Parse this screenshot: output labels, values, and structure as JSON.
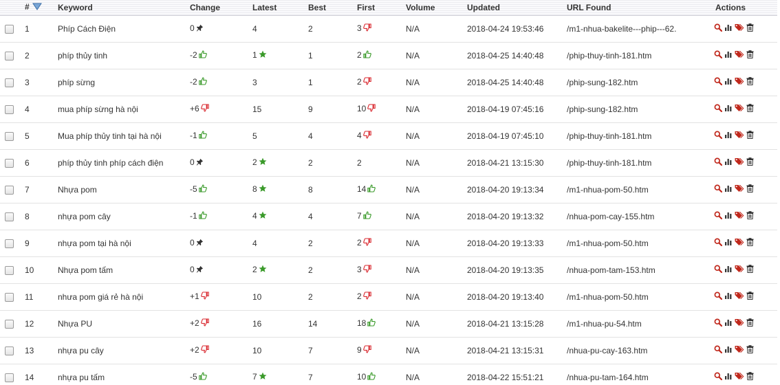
{
  "table": {
    "headers": {
      "index": "#",
      "keyword": "Keyword",
      "change": "Change",
      "latest": "Latest",
      "best": "Best",
      "first": "First",
      "volume": "Volume",
      "updated": "Updated",
      "url": "URL Found",
      "actions": "Actions"
    },
    "rows": [
      {
        "idx": "1",
        "keyword": "Phíp Cách Điện",
        "change": "0",
        "change_icon": "pin",
        "latest": "4",
        "latest_icon": "none",
        "best": "2",
        "first": "3",
        "first_icon": "thumbs-down",
        "volume": "N/A",
        "updated": "2018-04-24 19:53:46",
        "url": "/m1-nhua-bakelite---phip---62."
      },
      {
        "idx": "2",
        "keyword": "phíp thủy tinh",
        "change": "-2",
        "change_icon": "thumbs-up",
        "latest": "1",
        "latest_icon": "star",
        "best": "1",
        "first": "2",
        "first_icon": "thumbs-up",
        "volume": "N/A",
        "updated": "2018-04-25 14:40:48",
        "url": "/phip-thuy-tinh-181.htm"
      },
      {
        "idx": "3",
        "keyword": "phíp sừng",
        "change": "-2",
        "change_icon": "thumbs-up",
        "latest": "3",
        "latest_icon": "none",
        "best": "1",
        "first": "2",
        "first_icon": "thumbs-down",
        "volume": "N/A",
        "updated": "2018-04-25 14:40:48",
        "url": "/phip-sung-182.htm"
      },
      {
        "idx": "4",
        "keyword": "mua phíp sừng hà nội",
        "change": "+6",
        "change_icon": "thumbs-down",
        "latest": "15",
        "latest_icon": "none",
        "best": "9",
        "first": "10",
        "first_icon": "thumbs-down",
        "volume": "N/A",
        "updated": "2018-04-19 07:45:16",
        "url": "/phip-sung-182.htm"
      },
      {
        "idx": "5",
        "keyword": "Mua phíp thủy tinh tại hà nội",
        "change": "-1",
        "change_icon": "thumbs-up",
        "latest": "5",
        "latest_icon": "none",
        "best": "4",
        "first": "4",
        "first_icon": "thumbs-down",
        "volume": "N/A",
        "updated": "2018-04-19 07:45:10",
        "url": "/phip-thuy-tinh-181.htm"
      },
      {
        "idx": "6",
        "keyword": "phíp thủy tinh phíp cách điện",
        "change": "0",
        "change_icon": "pin",
        "latest": "2",
        "latest_icon": "star",
        "best": "2",
        "first": "2",
        "first_icon": "none",
        "volume": "N/A",
        "updated": "2018-04-21 13:15:30",
        "url": "/phip-thuy-tinh-181.htm"
      },
      {
        "idx": "7",
        "keyword": "Nhựa pom",
        "change": "-5",
        "change_icon": "thumbs-up",
        "latest": "8",
        "latest_icon": "star",
        "best": "8",
        "first": "14",
        "first_icon": "thumbs-up",
        "volume": "N/A",
        "updated": "2018-04-20 19:13:34",
        "url": "/m1-nhua-pom-50.htm"
      },
      {
        "idx": "8",
        "keyword": "nhựa pom cây",
        "change": "-1",
        "change_icon": "thumbs-up",
        "latest": "4",
        "latest_icon": "star",
        "best": "4",
        "first": "7",
        "first_icon": "thumbs-up",
        "volume": "N/A",
        "updated": "2018-04-20 19:13:32",
        "url": "/nhua-pom-cay-155.htm"
      },
      {
        "idx": "9",
        "keyword": "nhựa pom tại hà nội",
        "change": "0",
        "change_icon": "pin",
        "latest": "4",
        "latest_icon": "none",
        "best": "2",
        "first": "2",
        "first_icon": "thumbs-down",
        "volume": "N/A",
        "updated": "2018-04-20 19:13:33",
        "url": "/m1-nhua-pom-50.htm"
      },
      {
        "idx": "10",
        "keyword": "Nhựa pom tấm",
        "change": "0",
        "change_icon": "pin",
        "latest": "2",
        "latest_icon": "star",
        "best": "2",
        "first": "3",
        "first_icon": "thumbs-down",
        "volume": "N/A",
        "updated": "2018-04-20 19:13:35",
        "url": "/nhua-pom-tam-153.htm"
      },
      {
        "idx": "11",
        "keyword": "nhưa pom giá rẻ hà nội",
        "change": "+1",
        "change_icon": "thumbs-down",
        "latest": "10",
        "latest_icon": "none",
        "best": "2",
        "first": "2",
        "first_icon": "thumbs-down",
        "volume": "N/A",
        "updated": "2018-04-20 19:13:40",
        "url": "/m1-nhua-pom-50.htm"
      },
      {
        "idx": "12",
        "keyword": "Nhựa PU",
        "change": "+2",
        "change_icon": "thumbs-down",
        "latest": "16",
        "latest_icon": "none",
        "best": "14",
        "first": "18",
        "first_icon": "thumbs-up",
        "volume": "N/A",
        "updated": "2018-04-21 13:15:28",
        "url": "/m1-nhua-pu-54.htm"
      },
      {
        "idx": "13",
        "keyword": "nhựa pu cây",
        "change": "+2",
        "change_icon": "thumbs-down",
        "latest": "10",
        "latest_icon": "none",
        "best": "7",
        "first": "9",
        "first_icon": "thumbs-down",
        "volume": "N/A",
        "updated": "2018-04-21 13:15:31",
        "url": "/nhua-pu-cay-163.htm"
      },
      {
        "idx": "14",
        "keyword": "nhựa pu tấm",
        "change": "-5",
        "change_icon": "thumbs-up",
        "latest": "7",
        "latest_icon": "star",
        "best": "7",
        "first": "10",
        "first_icon": "thumbs-up",
        "volume": "N/A",
        "updated": "2018-04-22 15:51:21",
        "url": "/nhua-pu-tam-164.htm"
      }
    ]
  },
  "icons": {
    "sort": "sort-down-icon",
    "pin": "pin-icon",
    "thumbs_up": "thumbs-up-icon",
    "thumbs_down": "thumbs-down-icon",
    "star": "star-icon",
    "actions": [
      "search-icon",
      "chart-icon",
      "tag-icon",
      "trash-icon"
    ]
  },
  "colors": {
    "green": "#3a9a2a",
    "red": "#d9282f",
    "dark": "#333333",
    "tag": "#c0281c"
  }
}
